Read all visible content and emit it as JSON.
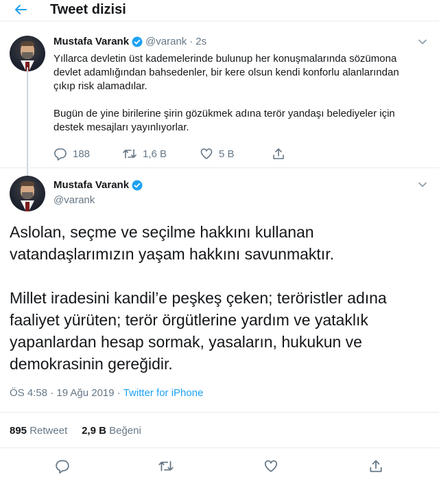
{
  "header": {
    "title": "Tweet dizisi"
  },
  "parent_tweet": {
    "name": "Mustafa Varank",
    "handle": "@varank",
    "separator": "·",
    "time": "2s",
    "lines": [
      "Yıllarca devletin üst kademelerinde bulunup her konuşmalarında sözümona",
      "devlet adamlığından bahsedenler, bir kere olsun kendi konforlu alanlarından",
      "çıkıp risk alamadılar.",
      "",
      "Bugün de yine birilerine şirin gözükmek adına terör yandaşı belediyeler için",
      "destek mesajları yayınlıyorlar."
    ],
    "replies": "188",
    "retweets": "1,6 B",
    "likes": "5 B"
  },
  "main_tweet": {
    "name": "Mustafa Varank",
    "handle": "@varank",
    "paragraphs": [
      "Aslolan, seçme ve seçilme hakkını kullanan vatandaşlarımızın yaşam hakkını savunmaktır.",
      "Millet iradesini kandil’e peşkeş çeken; teröristler adına faaliyet yürüten; terör örgütlerine yardım ve yataklık yapanlardan hesap sormak, yasaların, hukukun ve demokrasinin gereğidir."
    ],
    "timestamp": "ÖS 4:58 · 19 Ağu 2019 · ",
    "source": "Twitter for iPhone",
    "retweet_count": "895",
    "retweet_label": "Retweet",
    "like_count": "2,9 B",
    "like_label": "Beğeni"
  },
  "colors": {
    "accent": "#1da1f2",
    "secondary_text": "#657786",
    "border": "#e6ecf0"
  },
  "icons": [
    "back-arrow-icon",
    "verified-badge-icon",
    "chevron-down-icon",
    "reply-icon",
    "retweet-icon",
    "like-icon",
    "share-icon"
  ]
}
